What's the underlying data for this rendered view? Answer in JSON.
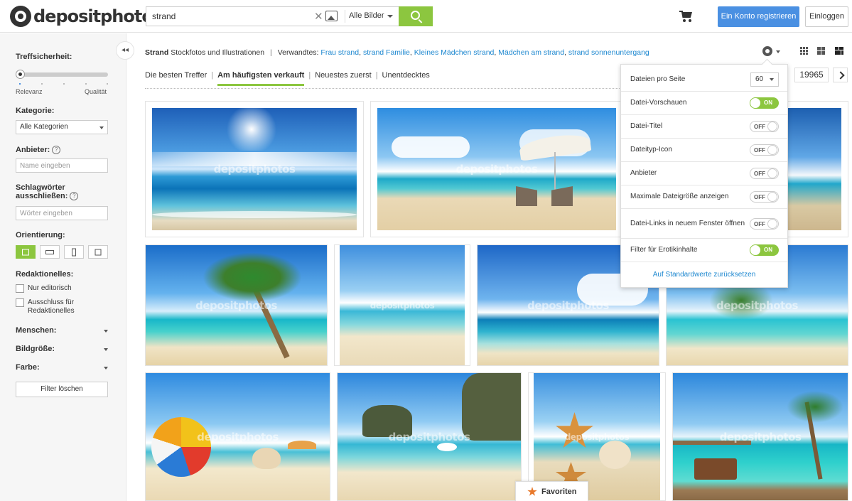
{
  "header": {
    "logo_text": "depositphotos",
    "search_value": "strand",
    "search_type": "Alle Bilder",
    "register_label": "Ein Konto registrieren",
    "login_label": "Einloggen"
  },
  "sidebar": {
    "accuracy_label": "Treffsicherheit:",
    "slider_left": "Relevanz",
    "slider_right": "Qualität",
    "category_label": "Kategorie:",
    "category_value": "Alle Kategorien",
    "provider_label": "Anbieter:",
    "provider_placeholder": "Name eingeben",
    "exclude_label_1": "Schlagwörter",
    "exclude_label_2": "ausschließen:",
    "exclude_placeholder": "Wörter eingeben",
    "orientation_label": "Orientierung:",
    "editorial_label": "Redaktionelles:",
    "editorial_only": "Nur editorisch",
    "editorial_exclude_1": "Ausschluss für",
    "editorial_exclude_2": "Redaktionelles",
    "people_label": "Menschen:",
    "size_label": "Bildgröße:",
    "color_label": "Farbe:",
    "clear_label": "Filter löschen"
  },
  "breadcrumb": {
    "keyword": "Strand",
    "suffix": "Stockfotos und Illustrationen",
    "related_label": "Verwandtes:",
    "related": [
      "Frau strand",
      "strand Familie",
      "Kleines Mädchen strand",
      "Mädchen am strand",
      "strand sonnenuntergang"
    ]
  },
  "sort_tabs": [
    "Die besten Treffer",
    "Am häufigsten verkauft",
    "Neuestes zuerst",
    "Unentdecktes"
  ],
  "active_sort": "Am häufigsten verkauft",
  "pagination": {
    "total": "19965"
  },
  "watermark": "depositphotos",
  "settings": {
    "rows": [
      {
        "label": "Dateien pro Seite",
        "kind": "select",
        "value": "60"
      },
      {
        "label": "Datei-Vorschauen",
        "kind": "toggle",
        "state": "ON"
      },
      {
        "label": "Datei-Titel",
        "kind": "toggle",
        "state": "OFF"
      },
      {
        "label": "Dateityp-Icon",
        "kind": "toggle",
        "state": "OFF"
      },
      {
        "label": "Anbieter",
        "kind": "toggle",
        "state": "OFF"
      },
      {
        "label": "Maximale Dateigröße anzeigen",
        "kind": "toggle",
        "state": "OFF"
      },
      {
        "label": "Datei-Links in neuem Fenster öffnen",
        "kind": "toggle",
        "state": "OFF"
      },
      {
        "label": "Filter für Erotikinhalte",
        "kind": "toggle",
        "state": "ON"
      }
    ],
    "reset_label": "Auf Standardwerte zurücksetzen"
  },
  "favorites_label": "Favoriten",
  "colors": {
    "accent_green": "#8cc63f",
    "link_blue": "#1e88d0",
    "register_blue": "#4a90e2",
    "star_orange": "#e8792b"
  }
}
